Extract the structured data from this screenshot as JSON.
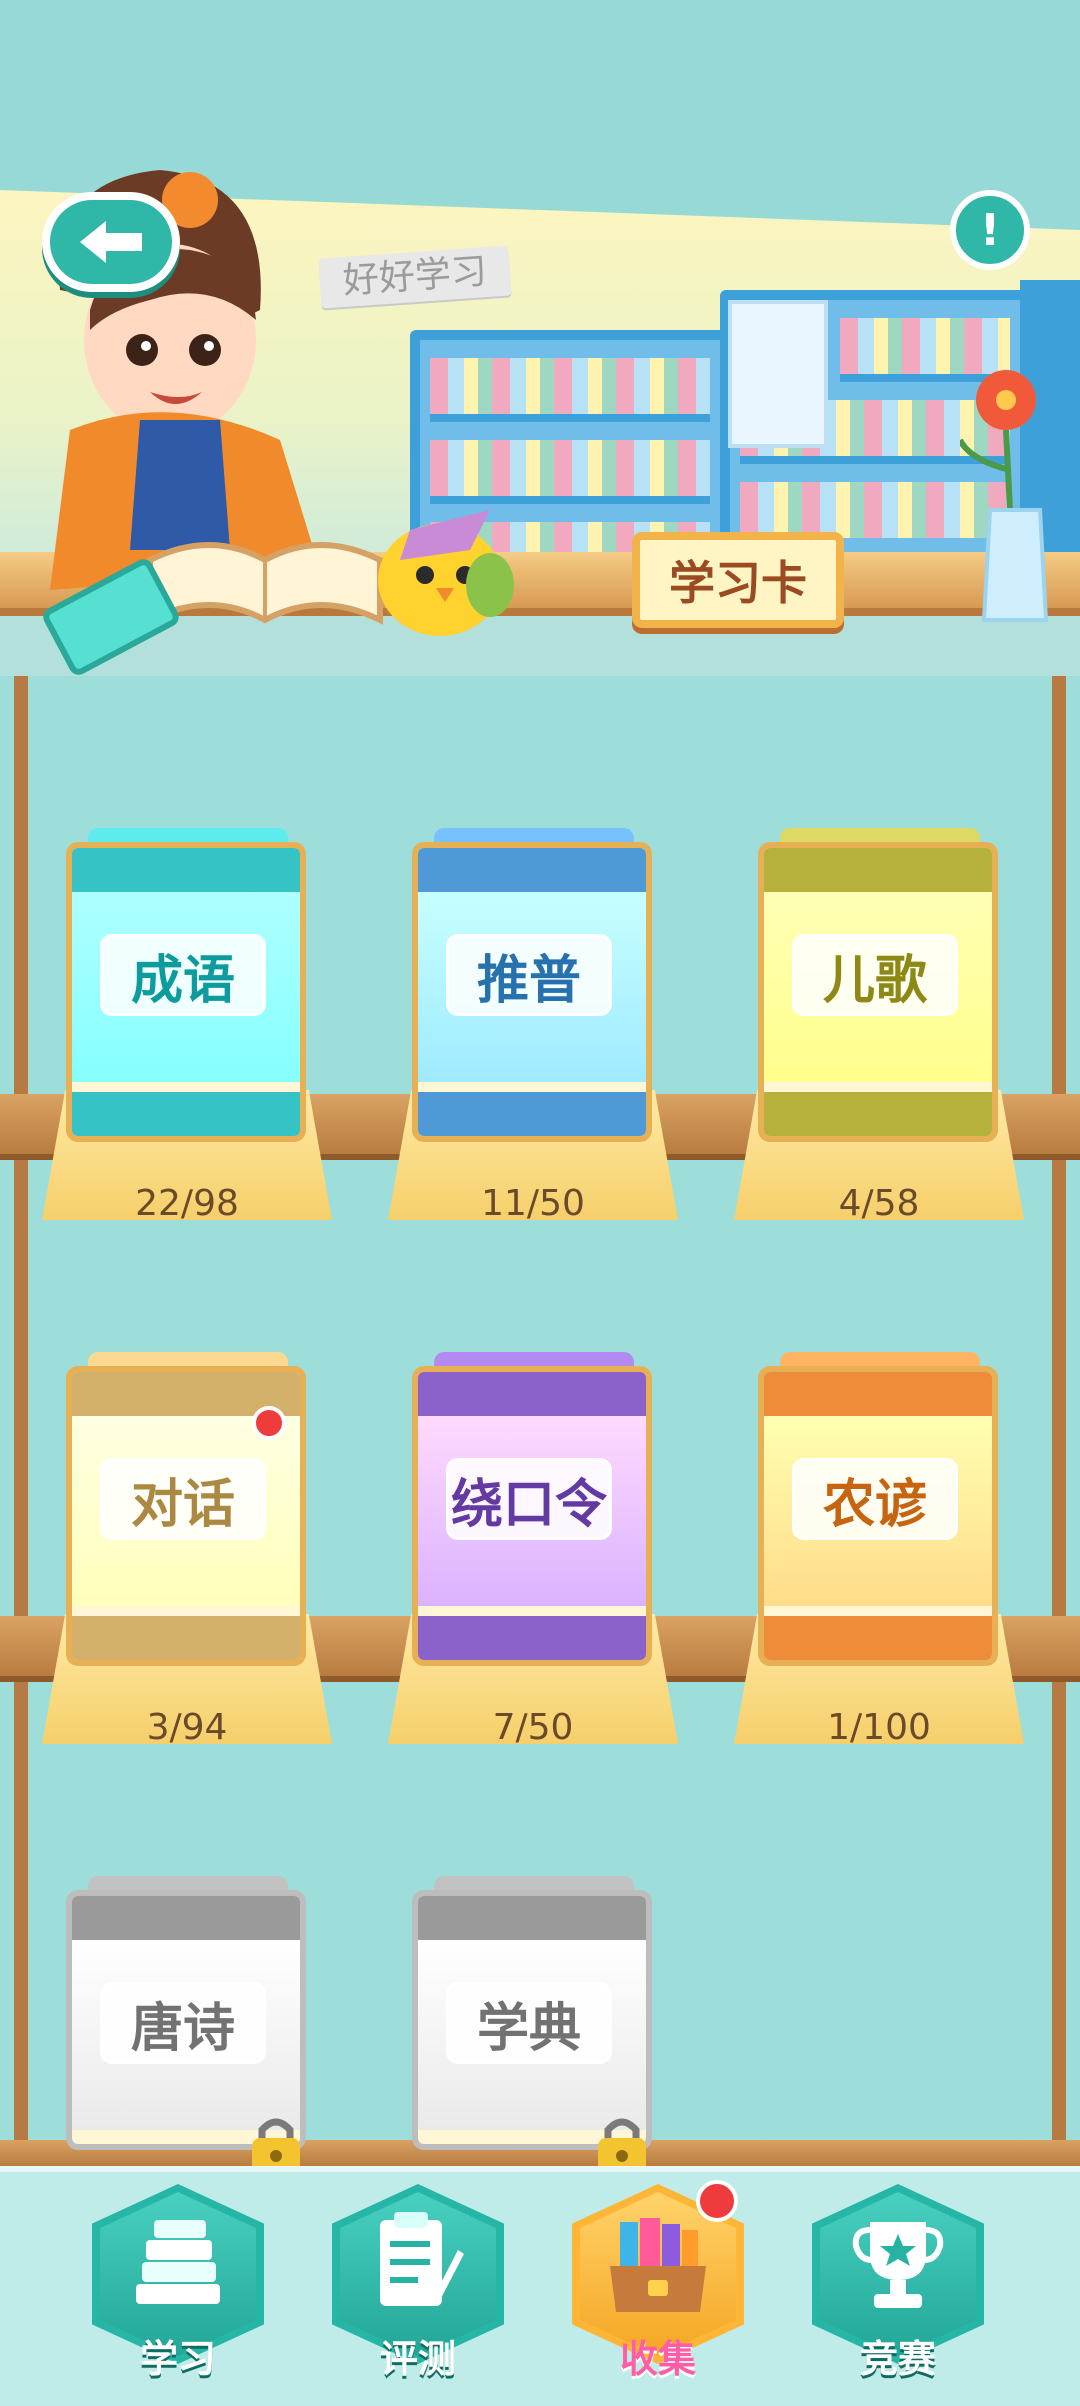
{
  "header": {
    "sign_text": "好好学习",
    "card_button_label": "学习卡",
    "info_symbol": "!"
  },
  "collections": [
    {
      "title": "成语",
      "progress": "22/98",
      "theme": "#36c3c6",
      "locked": false,
      "new": false
    },
    {
      "title": "推普",
      "progress": "11/50",
      "theme": "#4f9ad6",
      "locked": false,
      "new": false
    },
    {
      "title": "儿歌",
      "progress": "4/58",
      "theme": "#b6b13d",
      "locked": false,
      "new": false
    },
    {
      "title": "对话",
      "progress": "3/94",
      "theme": "#d3b16b",
      "locked": false,
      "new": true
    },
    {
      "title": "绕口令",
      "progress": "7/50",
      "theme": "#8a62c9",
      "locked": false,
      "new": false
    },
    {
      "title": "农谚",
      "progress": "1/100",
      "theme": "#ee8c3a",
      "locked": false,
      "new": false
    },
    {
      "title": "唐诗",
      "progress": "",
      "theme": "#9a9a9a",
      "locked": true,
      "new": false
    },
    {
      "title": "学典",
      "progress": "",
      "theme": "#9a9a9a",
      "locked": true,
      "new": false
    }
  ],
  "nav": [
    {
      "label": "学习",
      "icon": "books-icon",
      "active": false,
      "badge": false
    },
    {
      "label": "评测",
      "icon": "test-clipboard-icon",
      "active": false,
      "badge": false
    },
    {
      "label": "收集",
      "icon": "treasure-box-icon",
      "active": true,
      "badge": true
    },
    {
      "label": "竞赛",
      "icon": "trophy-icon",
      "active": false,
      "badge": false
    }
  ]
}
